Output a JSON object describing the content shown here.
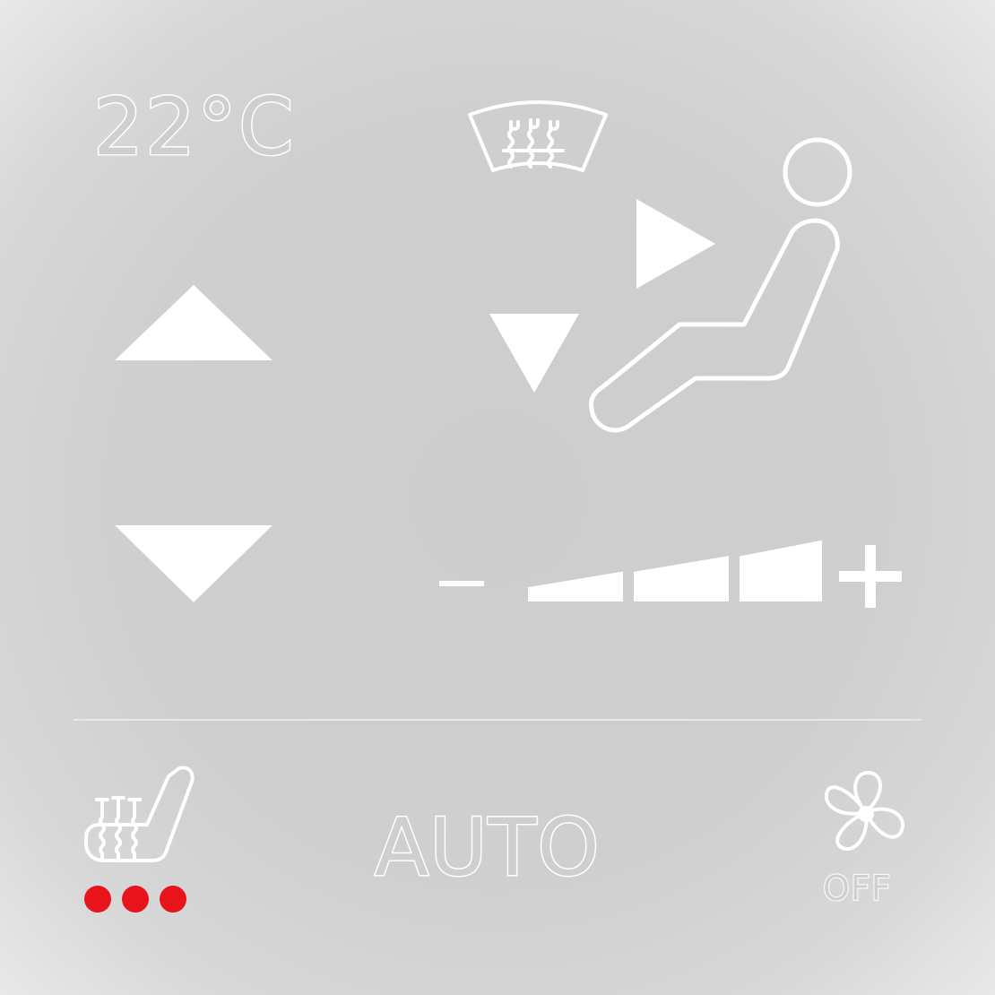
{
  "climate": {
    "temperature": "22°C",
    "mode_label": "AUTO",
    "fan_off_label": "OFF",
    "fan_speed_level": 3,
    "fan_speed_max": 3,
    "seat_heat_level": 3,
    "seat_heat_max": 3
  },
  "icons": {
    "temp_up": "triangle-up-icon",
    "temp_down": "triangle-down-icon",
    "windshield_defrost": "windshield-defrost-icon",
    "airflow_face": "arrow-right-icon",
    "airflow_feet": "arrow-down-icon",
    "seated_person": "seated-person-icon",
    "fan_minus": "minus-icon",
    "fan_plus": "plus-icon",
    "seat_heater": "seat-heater-icon",
    "fan": "fan-icon"
  },
  "colors": {
    "foreground": "#ffffff",
    "background": "#cfcfcf",
    "seat_heat_indicator": "#e8141c"
  }
}
